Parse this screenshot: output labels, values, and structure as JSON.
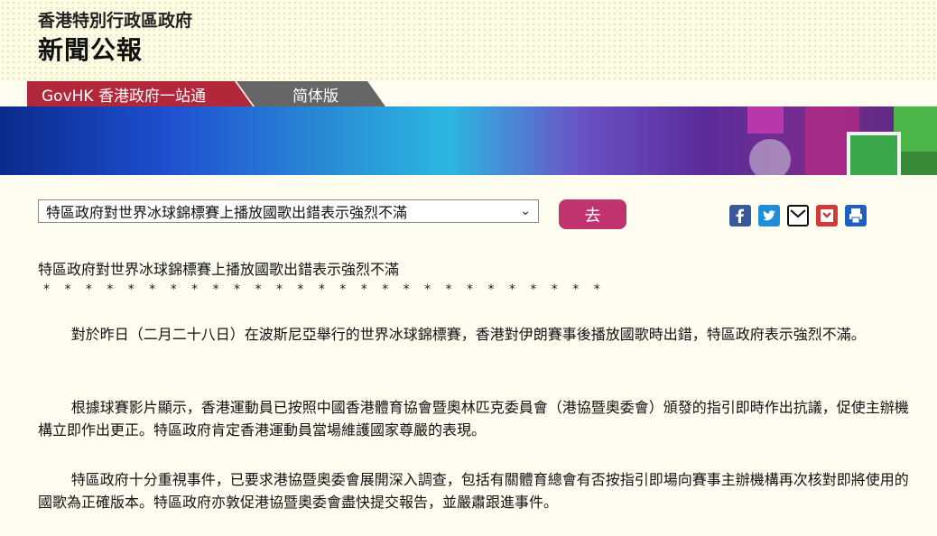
{
  "header": {
    "org_name": "香港特別行政區政府",
    "brand": "新聞公報"
  },
  "nav": {
    "govhk_tab": "GovHK 香港政府一站通",
    "simplified_tab": "简体版"
  },
  "topic_selector": {
    "selected": "特區政府對世界冰球錦標賽上播放國歌出錯表示強烈不滿",
    "go_label": "去"
  },
  "share_icons": [
    "facebook-icon",
    "twitter-icon",
    "email-icon",
    "bookmark-icon",
    "print-icon"
  ],
  "colors": {
    "accent": "#c0336e",
    "govhk_red": "#b2283a",
    "background": "#fffdf0"
  },
  "article": {
    "title": "特區政府對世界冰球錦標賽上播放國歌出錯表示強烈不滿",
    "separator": "* * * * * * * * * * * * * * * * * * * * * * * * * * *",
    "paragraphs": [
      "對於昨日（二月二十八日）在波斯尼亞舉行的世界冰球錦標賽，香港對伊朗賽事後播放國歌時出錯，特區政府表示強烈不滿。",
      "根據球賽影片顯示，香港運動員已按照中國香港體育協會暨奧林匹克委員會（港協暨奧委會）頒發的指引即時作出抗議，促使主辦機構立即作出更正。特區政府肯定香港運動員當場維護國家尊嚴的表現。",
      "特區政府十分重視事件，已要求港協暨奧委會展開深入調查，包括有關體育總會有否按指引即場向賽事主辦機構再次核對即將使用的國歌為正確版本。特區政府亦敦促港協暨奧委會盡快提交報告，並嚴肅跟進事件。"
    ]
  }
}
